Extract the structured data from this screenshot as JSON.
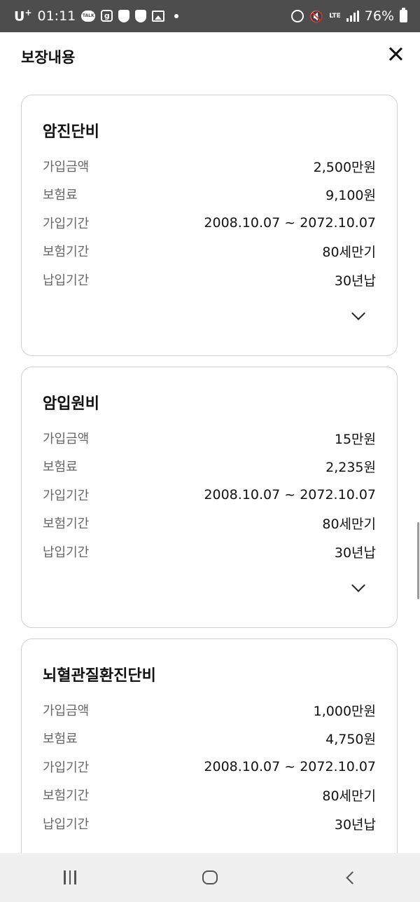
{
  "status_bar": {
    "carrier": "U",
    "carrier_sup": "+",
    "time": "01:11",
    "talk_label": "TALK",
    "g_label": "g",
    "lte_label": "LTE",
    "battery": "76%"
  },
  "header": {
    "title": "보장내용"
  },
  "cards": [
    {
      "title": "암진단비",
      "rows": [
        {
          "label": "가입금액",
          "value": "2,500만원"
        },
        {
          "label": "보험료",
          "value": "9,100원"
        },
        {
          "label": "가입기간",
          "value": "2008.10.07 ~ 2072.10.07"
        },
        {
          "label": "보험기간",
          "value": "80세만기"
        },
        {
          "label": "납입기간",
          "value": "30년납"
        }
      ]
    },
    {
      "title": "암입원비",
      "rows": [
        {
          "label": "가입금액",
          "value": "15만원"
        },
        {
          "label": "보험료",
          "value": "2,235원"
        },
        {
          "label": "가입기간",
          "value": "2008.10.07 ~ 2072.10.07"
        },
        {
          "label": "보험기간",
          "value": "80세만기"
        },
        {
          "label": "납입기간",
          "value": "30년납"
        }
      ]
    },
    {
      "title": "뇌혈관질환진단비",
      "rows": [
        {
          "label": "가입금액",
          "value": "1,000만원"
        },
        {
          "label": "보험료",
          "value": "4,750원"
        },
        {
          "label": "가입기간",
          "value": "2008.10.07 ~ 2072.10.07"
        },
        {
          "label": "보험기간",
          "value": "80세만기"
        },
        {
          "label": "납입기간",
          "value": "30년납"
        }
      ]
    }
  ],
  "icons": {
    "close": "close-icon",
    "expand": "chevron-down-icon",
    "nav_recents": "recents-icon",
    "nav_home": "home-icon",
    "nav_back": "back-icon"
  }
}
